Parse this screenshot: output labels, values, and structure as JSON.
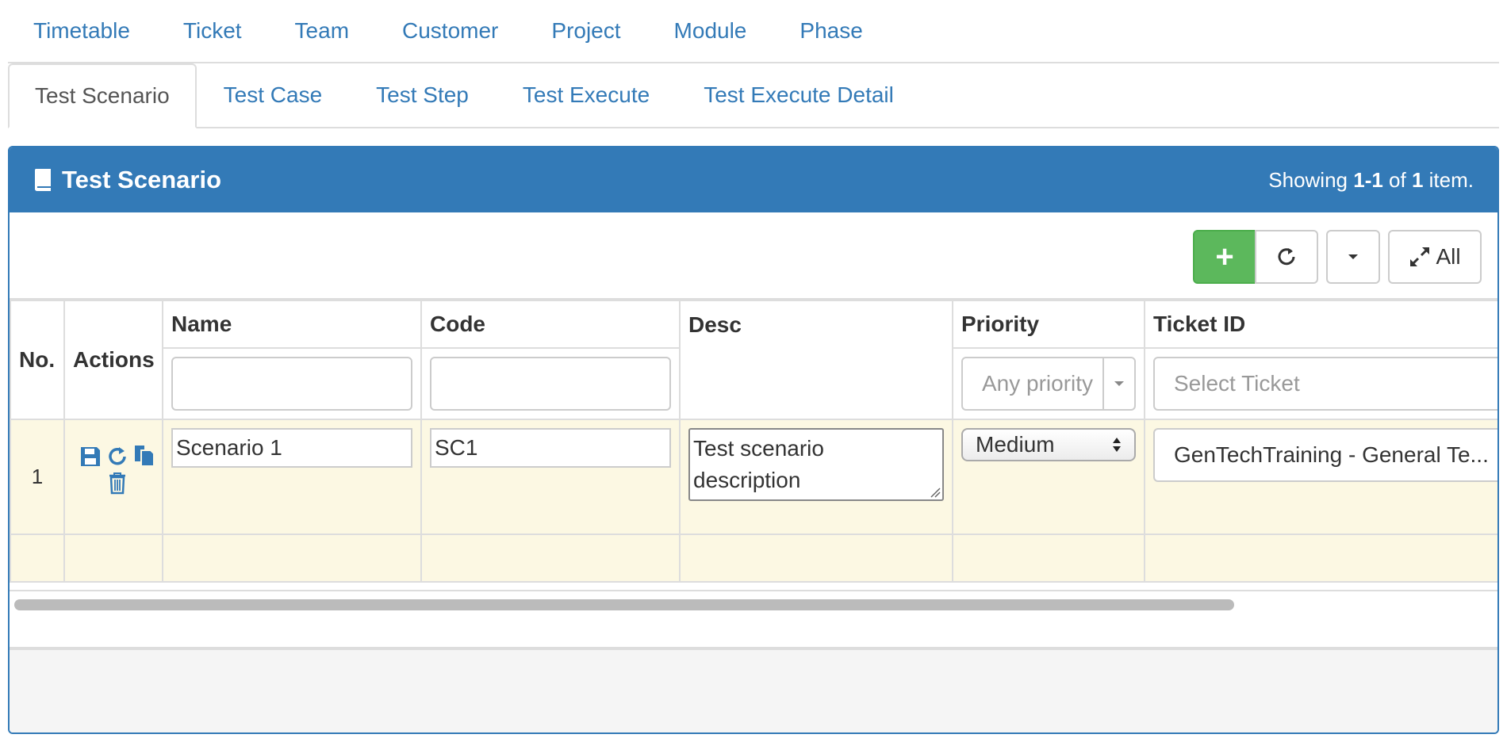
{
  "nav": {
    "items": [
      "Timetable",
      "Ticket",
      "Team",
      "Customer",
      "Project",
      "Module",
      "Phase"
    ]
  },
  "tabs": {
    "items": [
      "Test Scenario",
      "Test Case",
      "Test Step",
      "Test Execute",
      "Test Execute Detail"
    ],
    "active": "Test Scenario"
  },
  "panel": {
    "title": "Test Scenario",
    "summary_prefix": "Showing ",
    "summary_range": "1-1",
    "summary_of": " of ",
    "summary_total": "1",
    "summary_suffix": " item."
  },
  "toolbar": {
    "add_label": "+",
    "all_label": "All"
  },
  "table": {
    "headers": {
      "no": "No.",
      "actions": "Actions",
      "name": "Name",
      "code": "Code",
      "desc": "Desc",
      "priority": "Priority",
      "ticket": "Ticket ID"
    },
    "filters": {
      "name": "",
      "code": "",
      "priority_placeholder": "Any priority",
      "ticket_placeholder": "Select Ticket"
    },
    "rows": [
      {
        "no": "1",
        "name": "Scenario 1",
        "code": "SC1",
        "desc_line1": "Test scenario",
        "desc_line2": "description",
        "priority": "Medium",
        "ticket": "GenTechTraining - General Te..."
      }
    ]
  },
  "colors": {
    "primary": "#337ab7",
    "success": "#5cb85c",
    "row_highlight": "#fcf8e3"
  }
}
